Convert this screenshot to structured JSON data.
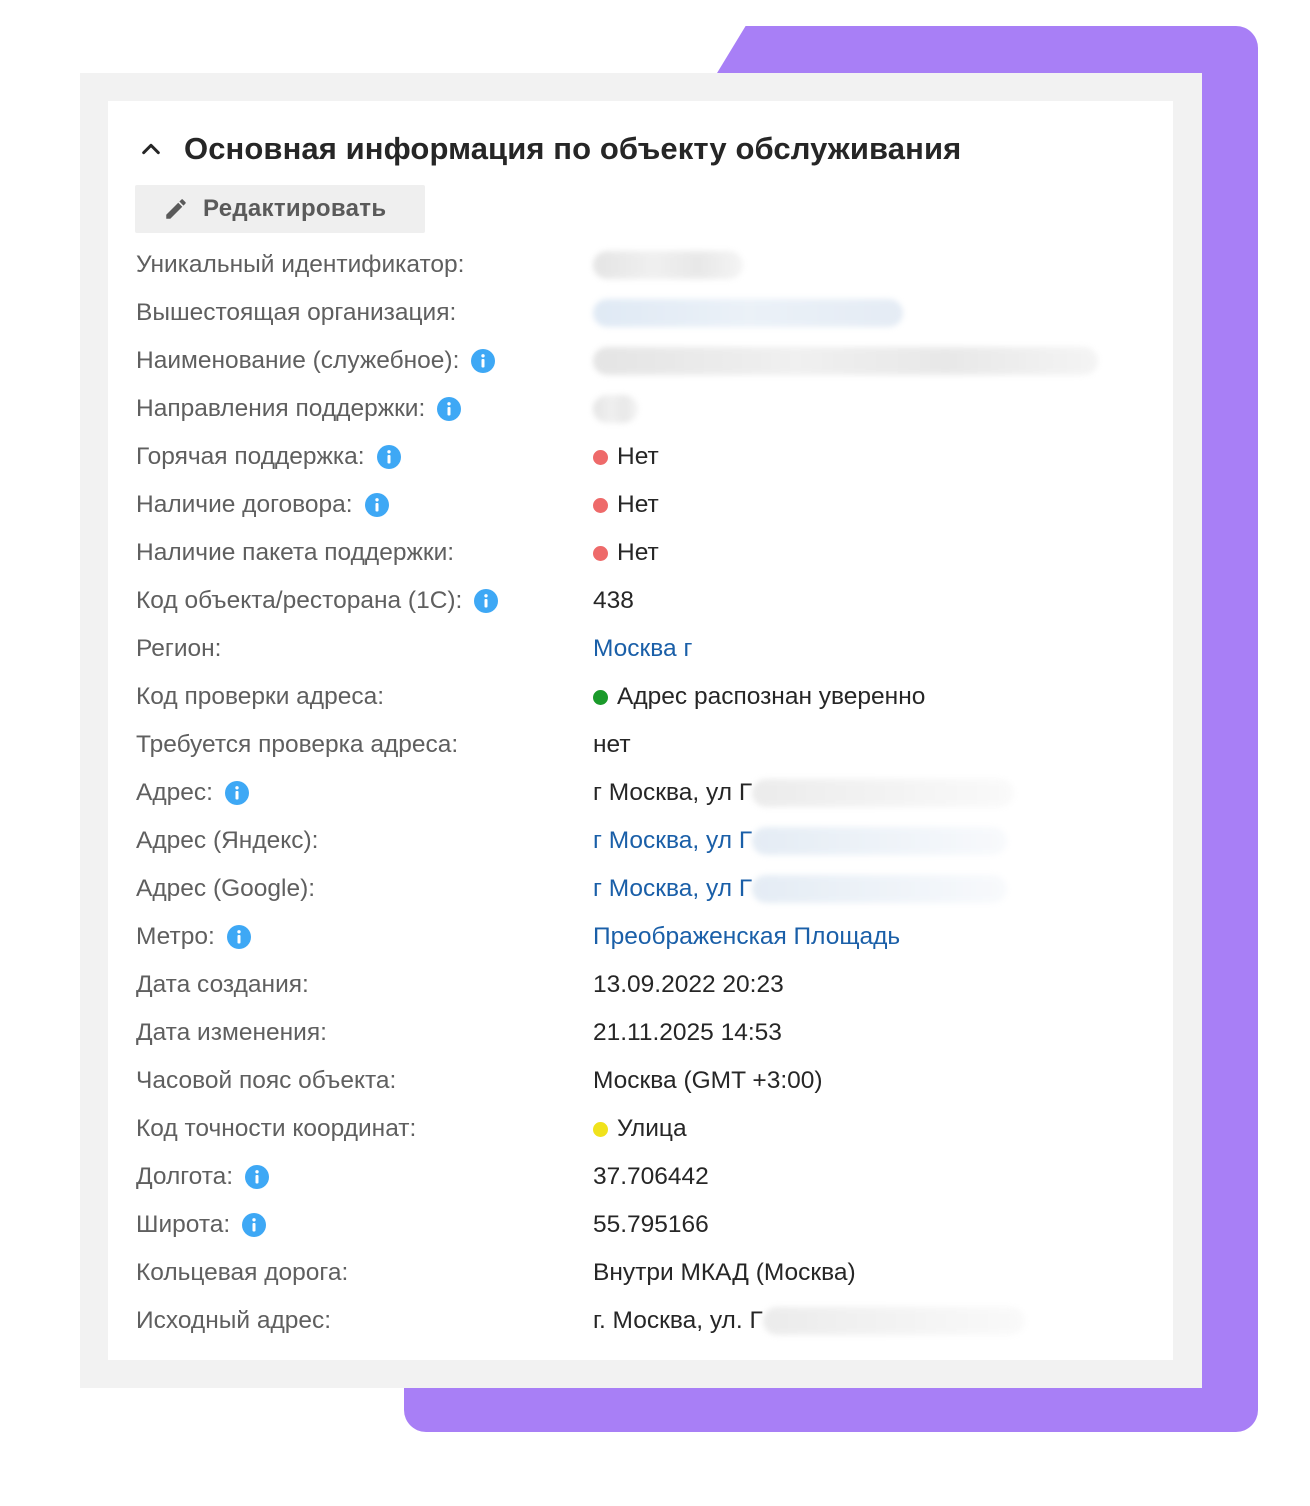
{
  "header": {
    "title": "Основная информация по объекту обслуживания",
    "edit_label": "Редактировать"
  },
  "colors": {
    "accent_shape": "#a87ff6",
    "info_icon": "#3ea8f5",
    "status_red": "#ee6a6a",
    "status_green": "#1a9a2a",
    "status_yellow": "#f0e21c",
    "link": "#1a5fa8"
  },
  "icons": {
    "collapse": "chevron-up-icon",
    "edit": "pencil-icon",
    "info": "info-icon"
  },
  "fields": {
    "uid": {
      "label": "Уникальный идентификатор:"
    },
    "parent_org": {
      "label": "Вышестоящая организация:"
    },
    "name": {
      "label": "Наименование (служебное):"
    },
    "directions": {
      "label": "Направления поддержки:"
    },
    "hot_support": {
      "label": "Горячая поддержка:",
      "value": "Нет"
    },
    "contract": {
      "label": "Наличие договора:",
      "value": "Нет"
    },
    "package": {
      "label": "Наличие пакета поддержки:",
      "value": "Нет"
    },
    "code": {
      "label": "Код объекта/ресторана (1С):",
      "value": "438"
    },
    "region": {
      "label": "Регион:",
      "value": "Москва г"
    },
    "address_check": {
      "label": "Код проверки адреса:",
      "value": "Адрес распознан уверенно"
    },
    "needs_check": {
      "label": "Требуется проверка адреса:",
      "value": "нет"
    },
    "address": {
      "label": "Адрес:",
      "value": "г Москва, ул Г"
    },
    "address_yandex": {
      "label": "Адрес (Яндекс):",
      "value": "г Москва, ул Г"
    },
    "address_google": {
      "label": "Адрес (Google):",
      "value": "г Москва, ул Г"
    },
    "metro": {
      "label": "Метро:",
      "value": "Преображенская Площадь"
    },
    "created": {
      "label": "Дата создания:",
      "value": "13.09.2022 20:23"
    },
    "modified": {
      "label": "Дата изменения:",
      "value": "21.11.2025 14:53"
    },
    "timezone": {
      "label": "Часовой пояс объекта:",
      "value": "Москва (GMT +3:00)"
    },
    "precision": {
      "label": "Код точности координат:",
      "value": "Улица"
    },
    "longitude": {
      "label": "Долгота:",
      "value": "37.706442"
    },
    "latitude": {
      "label": "Широта:",
      "value": "55.795166"
    },
    "ring_road": {
      "label": "Кольцевая дорога:",
      "value": "Внутри МКАД (Москва)"
    },
    "source_address": {
      "label": "Исходный адрес:",
      "value": "г. Москва, ул. Г"
    }
  }
}
